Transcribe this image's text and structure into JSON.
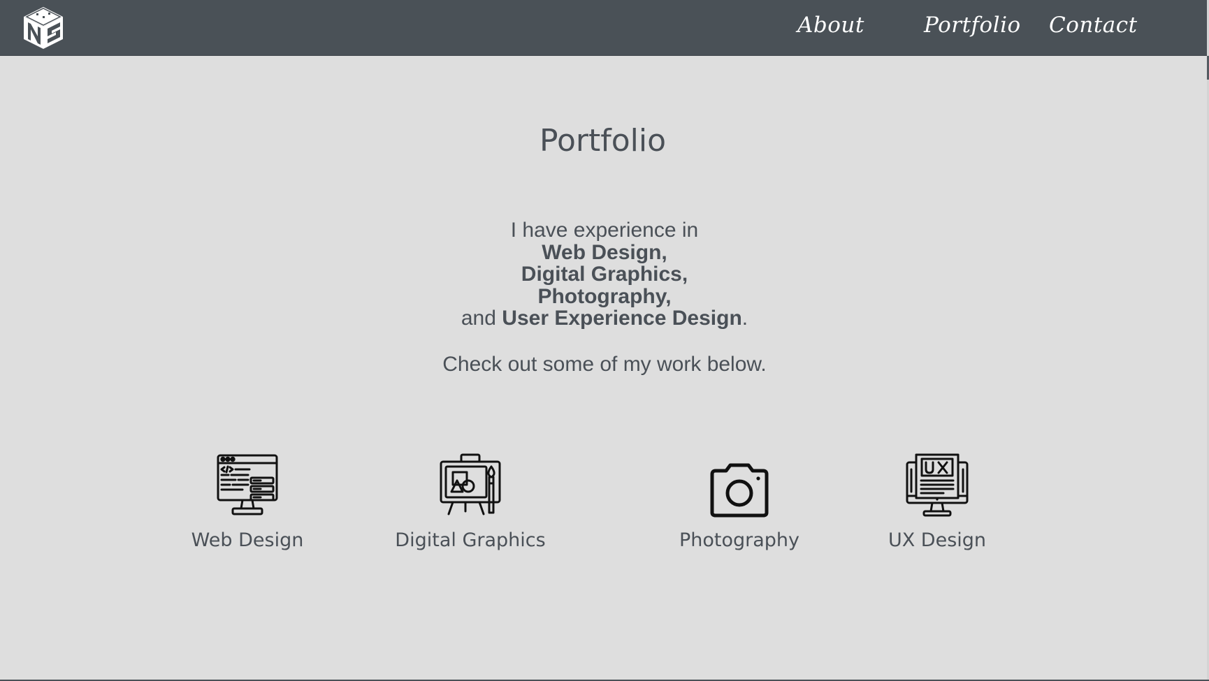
{
  "header": {
    "logo_icon": "ns-cube-logo-icon",
    "nav": [
      {
        "label": "About"
      },
      {
        "label": "Portfolio"
      },
      {
        "label": "Contact"
      }
    ]
  },
  "main": {
    "title": "Portfolio",
    "intro": {
      "prefix": "I have experience in",
      "skill_1": "Web Design,",
      "skill_2": "Digital Graphics,",
      "skill_3": "Photography,",
      "and_word": "and",
      "skill_4": "User Experience Design",
      "period": "."
    },
    "cta": "Check out some of my work below.",
    "categories": [
      {
        "label": "Web Design",
        "icon": "web-design-monitor-icon"
      },
      {
        "label": "Digital Graphics",
        "icon": "digital-graphics-easel-icon"
      },
      {
        "label": "Photography",
        "icon": "camera-icon"
      },
      {
        "label": "UX Design",
        "icon": "ux-design-monitor-icon"
      }
    ]
  },
  "colors": {
    "navbar": "#4a5157",
    "background": "#dedede",
    "text": "#4a5057",
    "nav_text": "#ffffff"
  }
}
